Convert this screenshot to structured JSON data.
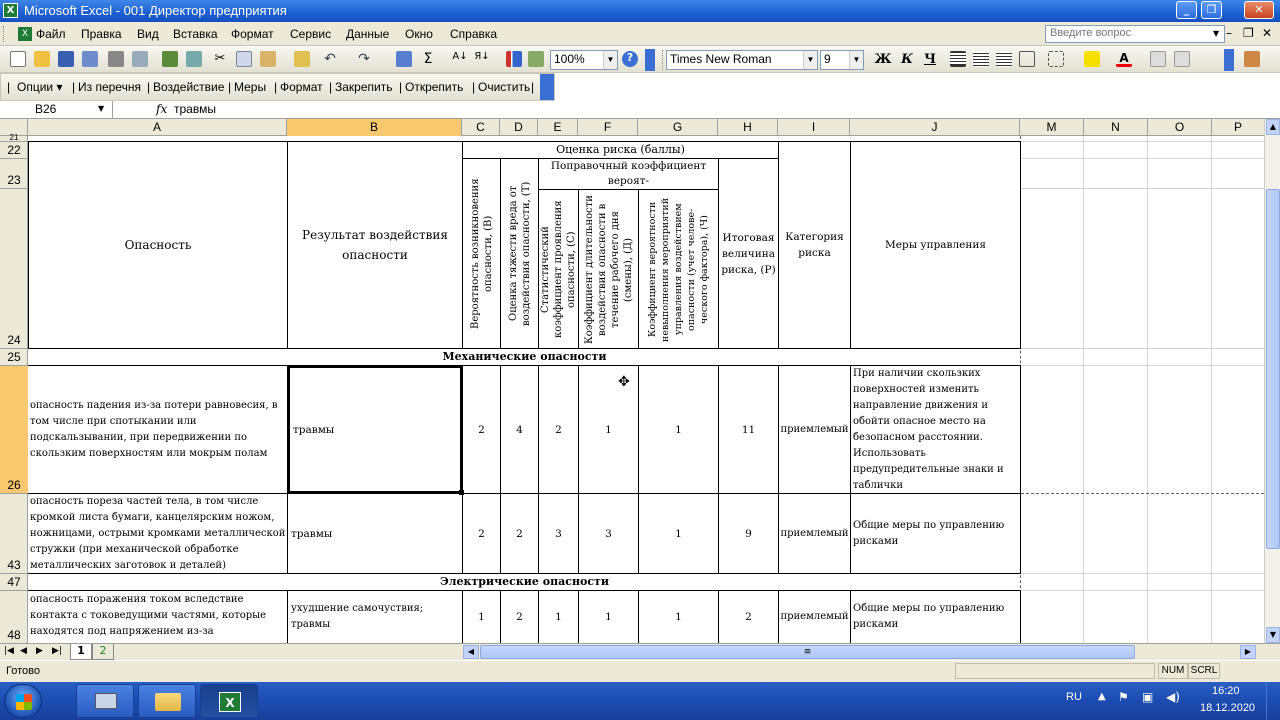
{
  "window": {
    "title": "Microsoft Excel - 001 Директор предприятия"
  },
  "menu": {
    "items": [
      "Файл",
      "Правка",
      "Вид",
      "Вставка",
      "Формат",
      "Сервис",
      "Данные",
      "Окно",
      "Справка"
    ],
    "ask_placeholder": "Введите вопрос"
  },
  "toolbar": {
    "zoom": "100%",
    "font": "Times New Roman",
    "font_size": "9",
    "bold": "Ж",
    "italic": "К",
    "underline": "Ч"
  },
  "custom_toolbar": {
    "items": [
      "Опции ▾",
      "Из перечня",
      "Воздействие",
      "Меры",
      "Формат",
      "Закрепить",
      "Открепить",
      "Очистить"
    ]
  },
  "formula_bar": {
    "name_box": "B26",
    "fx": "fx",
    "value": "травмы"
  },
  "columns": [
    "A",
    "B",
    "C",
    "D",
    "E",
    "F",
    "G",
    "H",
    "I",
    "J",
    "M",
    "N",
    "O",
    "P"
  ],
  "rows": [
    "21",
    "22",
    "23",
    "24",
    "25",
    "26",
    "43",
    "47",
    "48"
  ],
  "sheet": {
    "header": {
      "hazard": "Опасность",
      "result": "Результат воздействия опасности",
      "risk_assessment": "Оценка риска (баллы)",
      "correction": "Поправочный коэффициент вероят-",
      "col_c": "Вероятность возникновения опасности, (В)",
      "col_d": "Оценка тяжести вреда от воздействия опасности, (Т)",
      "col_e": "Статистический коэффициент проявления опасности, (С)",
      "col_f": "Коэффициент длительности воздействия опасности в течение рабочего дня (смены), (Д)",
      "col_g": "Коэффициент вероятности невыполнения мероприятий управления воздействием опасности (учет челове-ческого фактора), (Ч)",
      "total": "Итоговая величина риска, (Р)",
      "category": "Категория риска",
      "measures": "Меры управления"
    },
    "sections": {
      "mechanical": "Механические опасности",
      "electrical": "Электрические опасности"
    },
    "data_rows": [
      {
        "hazard": "опасность падения из-за потери равновесия, в том числе при спотыкании или подскальзывании, при передвижении по скользким поверхностям или мокрым полам",
        "result": "травмы",
        "c": "2",
        "d": "4",
        "e": "2",
        "f": "1",
        "g": "1",
        "h": "11",
        "category": "приемлемый",
        "measures": "При наличии скользких поверхностей изменить направление движения и обойти опасное место на безопасном расстоянии. Использовать предупредительные знаки и таблички"
      },
      {
        "hazard": "опасность пореза частей тела, в том числе кромкой листа бумаги, канцелярским ножом, ножницами, острыми кромками металлической стружки (при механической обработке металлических заготовок и деталей)",
        "result": "травмы",
        "c": "2",
        "d": "2",
        "e": "3",
        "f": "3",
        "g": "1",
        "h": "9",
        "category": "приемлемый",
        "measures": "Общие меры по  управлению рисками"
      },
      {
        "hazard": "опасность поражения током вследствие контакта с токоведущими частями, которые находятся под напряжением из-за неисправного состояния",
        "result": "ухудшение самочуствия; травмы",
        "c": "1",
        "d": "2",
        "e": "1",
        "f": "1",
        "g": "1",
        "h": "2",
        "category": "приемлемый",
        "measures": "Общие меры по  управлению рисками"
      }
    ]
  },
  "tabs": [
    "1",
    "2"
  ],
  "status": {
    "ready": "Готово",
    "num": "NUM",
    "scrl": "SCRL"
  },
  "taskbar": {
    "lang": "RU",
    "time": "16:20",
    "date": "18.12.2020"
  }
}
